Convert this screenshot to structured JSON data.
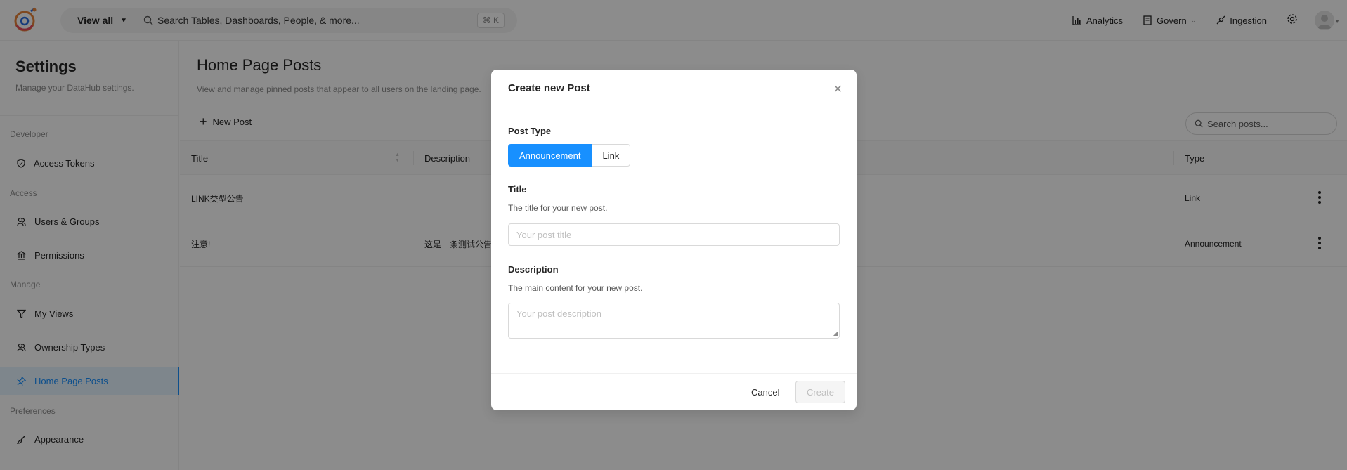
{
  "header": {
    "view_all_label": "View all",
    "search_placeholder": "Search Tables, Dashboards, People, & more...",
    "shortcut": "⌘ K",
    "nav": [
      {
        "label": "Analytics",
        "icon": "bar-chart-icon"
      },
      {
        "label": "Govern",
        "icon": "book-icon"
      },
      {
        "label": "Ingestion",
        "icon": "api-icon"
      }
    ]
  },
  "sidebar": {
    "title": "Settings",
    "subtitle": "Manage your DataHub settings.",
    "sections": {
      "developer": "Developer",
      "access": "Access",
      "manage": "Manage",
      "preferences": "Preferences"
    },
    "items": {
      "access_tokens": "Access Tokens",
      "users_groups": "Users & Groups",
      "permissions": "Permissions",
      "my_views": "My Views",
      "ownership_types": "Ownership Types",
      "home_page_posts": "Home Page Posts",
      "appearance": "Appearance"
    }
  },
  "main": {
    "title": "Home Page Posts",
    "subtitle": "View and manage pinned posts that appear to all users on the landing page.",
    "new_post_label": "New Post",
    "search_posts_placeholder": "Search posts...",
    "columns": {
      "title": "Title",
      "description": "Description",
      "type": "Type"
    },
    "rows": [
      {
        "title": "LINK类型公告",
        "description": "",
        "type": "Link"
      },
      {
        "title": "注意!",
        "description": "这是一条测试公告",
        "type": "Announcement"
      }
    ]
  },
  "modal": {
    "title": "Create new Post",
    "post_type_label": "Post Type",
    "post_types": [
      "Announcement",
      "Link"
    ],
    "selected_type": "Announcement",
    "title_label": "Title",
    "title_help": "The title for your new post.",
    "title_placeholder": "Your post title",
    "description_label": "Description",
    "description_help": "The main content for your new post.",
    "description_placeholder": "Your post description",
    "cancel_label": "Cancel",
    "create_label": "Create"
  },
  "colors": {
    "accent": "#1890ff",
    "active_bg": "#e6f4ff"
  }
}
